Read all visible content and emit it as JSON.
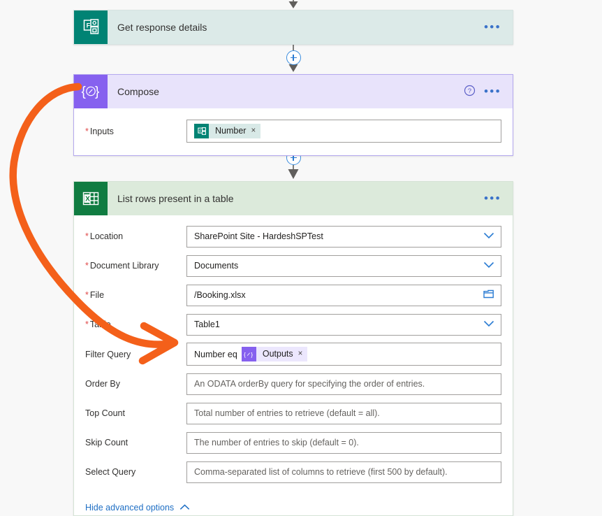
{
  "canvas": {
    "background": "#f8f8f8",
    "annotation_color": "#f4601a"
  },
  "cards": [
    {
      "id": "get-response-details",
      "title": "Get response details",
      "icon": "microsoft-forms-icon",
      "header_bg": "#dceae8",
      "icon_bg": "#018374",
      "overflow_label": "•••"
    },
    {
      "id": "compose",
      "title": "Compose",
      "icon": "compose-braces-icon",
      "header_bg": "#e8e3fb",
      "icon_bg": "#8661ef",
      "help_label": "?",
      "overflow_label": "•••",
      "fields": [
        {
          "label": "Inputs",
          "required": true,
          "type": "token-field",
          "token": {
            "text": "Number",
            "source": "microsoft-forms-icon",
            "remove": "×"
          }
        }
      ]
    },
    {
      "id": "list-rows-present-in-a-table",
      "title": "List rows present in a table",
      "icon": "excel-icon",
      "header_bg": "#dceadb",
      "icon_bg": "#107c41",
      "overflow_label": "•••",
      "fields": [
        {
          "label": "Location",
          "required": true,
          "type": "dropdown",
          "value": "SharePoint Site - HardeshSPTest"
        },
        {
          "label": "Document Library",
          "required": true,
          "type": "dropdown",
          "value": "Documents"
        },
        {
          "label": "File",
          "required": true,
          "type": "file-picker",
          "value": "/Booking.xlsx"
        },
        {
          "label": "Table",
          "required": true,
          "type": "dropdown",
          "value": "Table1"
        },
        {
          "label": "Filter Query",
          "required": false,
          "type": "token-field",
          "prefix": "Number eq",
          "token": {
            "text": "Outputs",
            "source": "compose-braces-icon",
            "remove": "×"
          }
        },
        {
          "label": "Order By",
          "required": false,
          "type": "text",
          "value": "",
          "placeholder": "An ODATA orderBy query for specifying the order of entries."
        },
        {
          "label": "Top Count",
          "required": false,
          "type": "text",
          "value": "",
          "placeholder": "Total number of entries to retrieve (default = all)."
        },
        {
          "label": "Skip Count",
          "required": false,
          "type": "text",
          "value": "",
          "placeholder": "The number of entries to skip (default = 0)."
        },
        {
          "label": "Select Query",
          "required": false,
          "type": "text",
          "value": "",
          "placeholder": "Comma-separated list of columns to retrieve (first 500 by default)."
        }
      ],
      "advanced_toggle": {
        "label": "Hide advanced options",
        "chevron": "chevron-up-icon"
      }
    }
  ],
  "connectors": [
    {
      "name": "connector-top-to-forms",
      "has_plus": false
    },
    {
      "name": "connector-forms-to-compose",
      "has_plus": true,
      "plus_label": "+"
    },
    {
      "name": "connector-compose-to-excel",
      "has_plus": true,
      "plus_label": "+"
    },
    {
      "name": "connector-excel-to-next",
      "has_plus": false
    }
  ]
}
